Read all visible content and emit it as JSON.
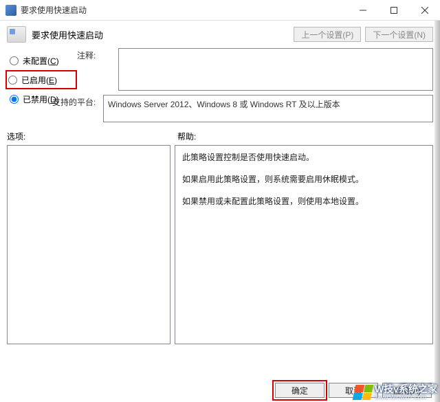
{
  "titlebar": {
    "title": "要求使用快速启动"
  },
  "header": {
    "title": "要求使用快速启动",
    "prev_btn": "上一个设置(P)",
    "next_btn": "下一个设置(N)"
  },
  "radios": {
    "not_configured": {
      "label": "未配置(",
      "hotkey": "C",
      "suffix": ")",
      "checked": false
    },
    "enabled": {
      "label": "已启用(",
      "hotkey": "E",
      "suffix": ")",
      "checked": false
    },
    "disabled": {
      "label": "已禁用(",
      "hotkey": "D",
      "suffix": ")",
      "checked": true
    }
  },
  "comments": {
    "label": "注释:",
    "value": ""
  },
  "platform": {
    "label": "支持的平台:",
    "text": "Windows Server 2012、Windows 8 或 Windows RT 及以上版本"
  },
  "options": {
    "label": "选项:"
  },
  "help": {
    "label": "帮助:",
    "paragraphs": [
      "此策略设置控制是否使用快速启动。",
      "如果启用此策略设置，则系统需要启用休眠模式。",
      "如果禁用或未配置此策略设置，则使用本地设置。"
    ]
  },
  "footer": {
    "ok": "确定",
    "cancel": "取消",
    "apply": "应用(A)"
  },
  "watermark": {
    "brand": "W技v系统之家",
    "url": "www.Winwin7.com"
  }
}
